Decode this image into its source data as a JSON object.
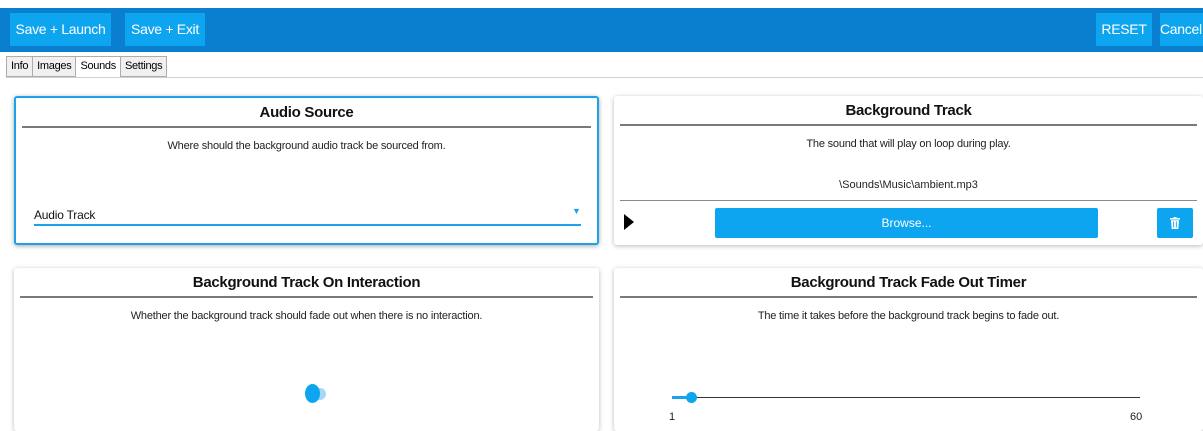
{
  "toolbar": {
    "save_launch_label": "Save + Launch",
    "save_exit_label": "Save + Exit",
    "reset_label": "RESET",
    "cancel_label": "Cancel"
  },
  "tabs": [
    {
      "label": "Info",
      "active": false
    },
    {
      "label": "Images",
      "active": false
    },
    {
      "label": "Sounds",
      "active": true
    },
    {
      "label": "Settings",
      "active": false
    }
  ],
  "cards": {
    "audio_source": {
      "title": "Audio Source",
      "description": "Where should the background audio track be sourced from.",
      "selected_value": "Audio Track"
    },
    "background_track": {
      "title": "Background Track",
      "description": "The sound that will play on loop during play.",
      "file_path": "\\Sounds\\Music\\ambient.mp3",
      "browse_label": "Browse..."
    },
    "interaction": {
      "title": "Background Track On Interaction",
      "description": "Whether the background track should fade out when there is no interaction.",
      "toggle_on": true
    },
    "fade_timer": {
      "title": "Background Track Fade Out Timer",
      "description": "The time it takes before the background track begins to fade out.",
      "min_label": "1",
      "max_label": "60",
      "value": 1
    }
  },
  "colors": {
    "toolbar_bg": "#0a7fcf",
    "button_bg": "#0ea5f0",
    "accent": "#1aa3e8"
  }
}
